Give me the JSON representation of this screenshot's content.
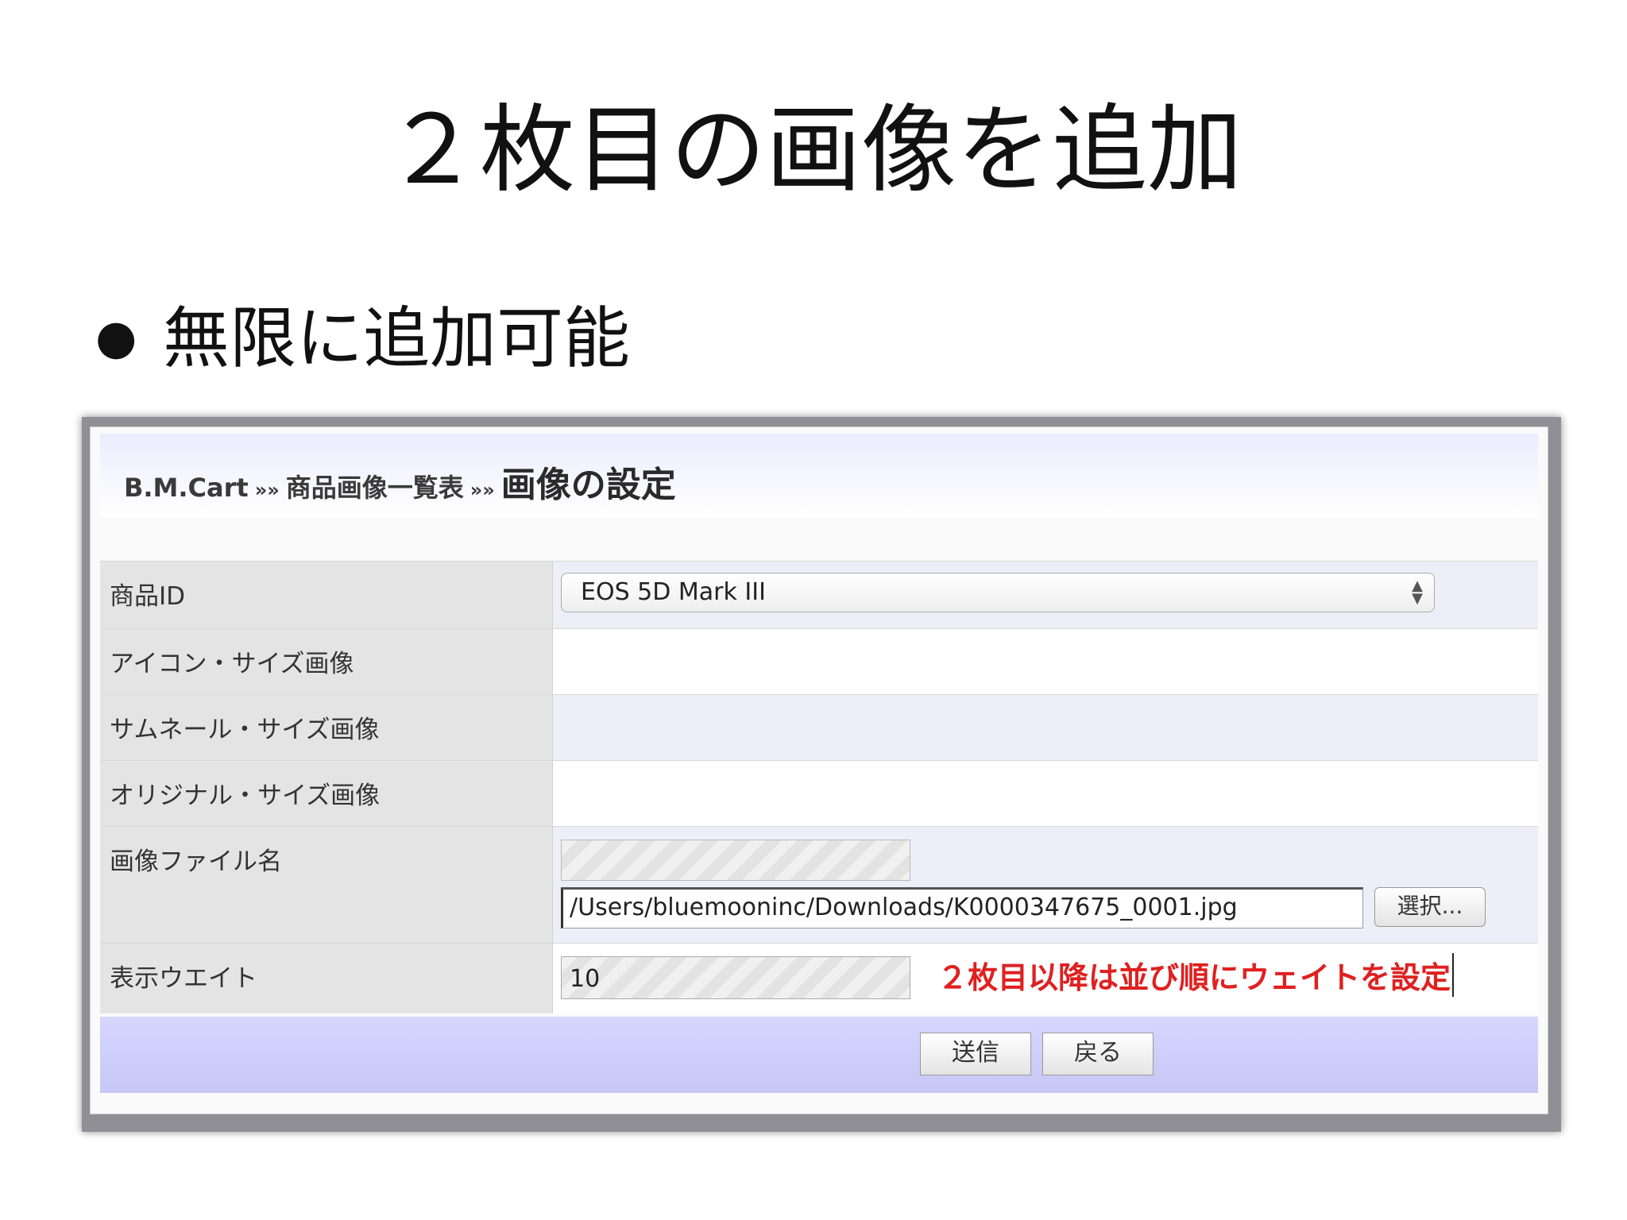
{
  "slide": {
    "title": "２枚目の画像を追加",
    "bullet": "無限に追加可能"
  },
  "window": {
    "breadcrumb": {
      "root": "B.M.Cart",
      "sep": "»»",
      "list": "商品画像一覧表",
      "current": "画像の設定"
    },
    "form": {
      "product_id_label": "商品ID",
      "product_id_value": "EOS 5D Mark III",
      "icon_size_label": "アイコン・サイズ画像",
      "thumb_size_label": "サムネール・サイズ画像",
      "original_size_label": "オリジナル・サイズ画像",
      "file_name_label": "画像ファイル名",
      "file_path": "/Users/bluemooninc/Downloads/K0000347675_0001.jpg",
      "choose_label": "選択...",
      "weight_label": "表示ウエイト",
      "weight_value": "10",
      "weight_note": "２枚目以降は並び順にウェイトを設定"
    },
    "buttons": {
      "submit": "送信",
      "back": "戻る"
    }
  }
}
